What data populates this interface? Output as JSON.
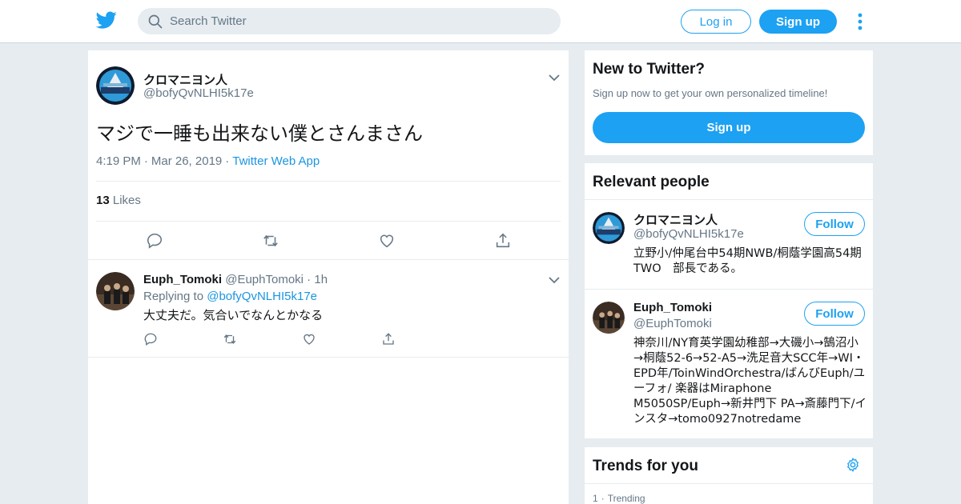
{
  "header": {
    "search_placeholder": "Search Twitter",
    "login_label": "Log in",
    "signup_label": "Sign up"
  },
  "tweet": {
    "author_name": "クロマニヨン人",
    "author_handle": "@bofyQvNLHI5k17e",
    "text": "マジで一睡も出来ない僕とさんまさん",
    "time": "4:19 PM",
    "date": "Mar 26, 2019",
    "source": "Twitter Web App",
    "likes_count": "13",
    "likes_label": "Likes"
  },
  "reply": {
    "author_name": "Euph_Tomoki",
    "author_handle": "@EuphTomoki",
    "age": "1h",
    "replying_prefix": "Replying to",
    "replying_to": "@bofyQvNLHI5k17e",
    "text": "大丈夫だ。気合いでなんとかなる"
  },
  "sidebar": {
    "new_title": "New to Twitter?",
    "new_subtitle": "Sign up now to get your own personalized timeline!",
    "signup_label": "Sign up",
    "people_title": "Relevant people",
    "people": [
      {
        "name": "クロマニヨン人",
        "handle": "@bofyQvNLHI5k17e",
        "bio": "立野小/仲尾台中54期NWB/桐蔭学園高54期TWO　部長である。",
        "follow_label": "Follow"
      },
      {
        "name": "Euph_Tomoki",
        "handle": "@EuphTomoki",
        "bio": "神奈川/NY育英学園幼稚部→大磯小→鵠沼小→桐蔭52-6→52-A5→洗足音大SCC年→WI・EPD年/ToinWindOrchestra/ばんびEuph/ユーフォ/ 楽器はMiraphone M5050SP/Euph→新井門下 PA→斎藤門下/インスタ→tomo0927notredame",
        "follow_label": "Follow"
      }
    ],
    "trends_title": "Trends for you",
    "trend_rank": "1",
    "trend_label": "Trending"
  },
  "colors": {
    "accent": "#1da1f2",
    "link": "#1b95e0",
    "muted": "#657786",
    "background": "#e6ecf0"
  },
  "icons": [
    "twitter-bird-icon",
    "search-icon",
    "more-vertical-icon",
    "chevron-down-icon",
    "reply-icon",
    "retweet-icon",
    "like-icon",
    "share-icon",
    "gear-icon"
  ]
}
